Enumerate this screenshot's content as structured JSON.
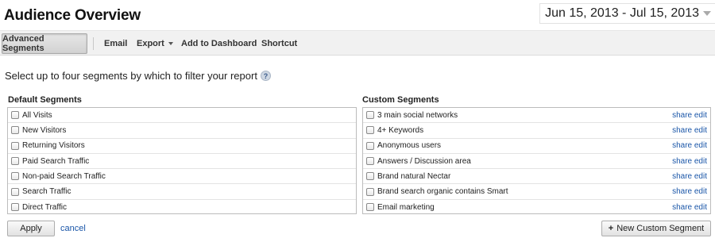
{
  "header": {
    "title": "Audience Overview",
    "date_range": "Jun 15, 2013 - Jul 15, 2013"
  },
  "toolbar": {
    "advanced_segments": "Advanced Segments",
    "email": "Email",
    "export": "Export",
    "add_to_dashboard": "Add to Dashboard",
    "shortcut": "Shortcut"
  },
  "instruction": "Select up to four segments by which to filter your report",
  "help_glyph": "?",
  "default_segments": {
    "title": "Default Segments",
    "items": [
      "All Visits",
      "New Visitors",
      "Returning Visitors",
      "Paid Search Traffic",
      "Non-paid Search Traffic",
      "Search Traffic",
      "Direct Traffic"
    ]
  },
  "custom_segments": {
    "title": "Custom Segments",
    "share_label": "share",
    "edit_label": "edit",
    "items": [
      "3 main social networks",
      "4+ Keywords",
      "Anonymous users",
      "Answers / Discussion area",
      "Brand natural Nectar",
      "Brand search organic contains Smart",
      "Email marketing"
    ]
  },
  "footer": {
    "apply": "Apply",
    "cancel": "cancel",
    "new_custom_segment": "New Custom Segment",
    "new_custom_segment_prefix": "+"
  },
  "colors": {
    "link": "#1a56a8",
    "toolbar_bg": "#f1f1f1"
  }
}
